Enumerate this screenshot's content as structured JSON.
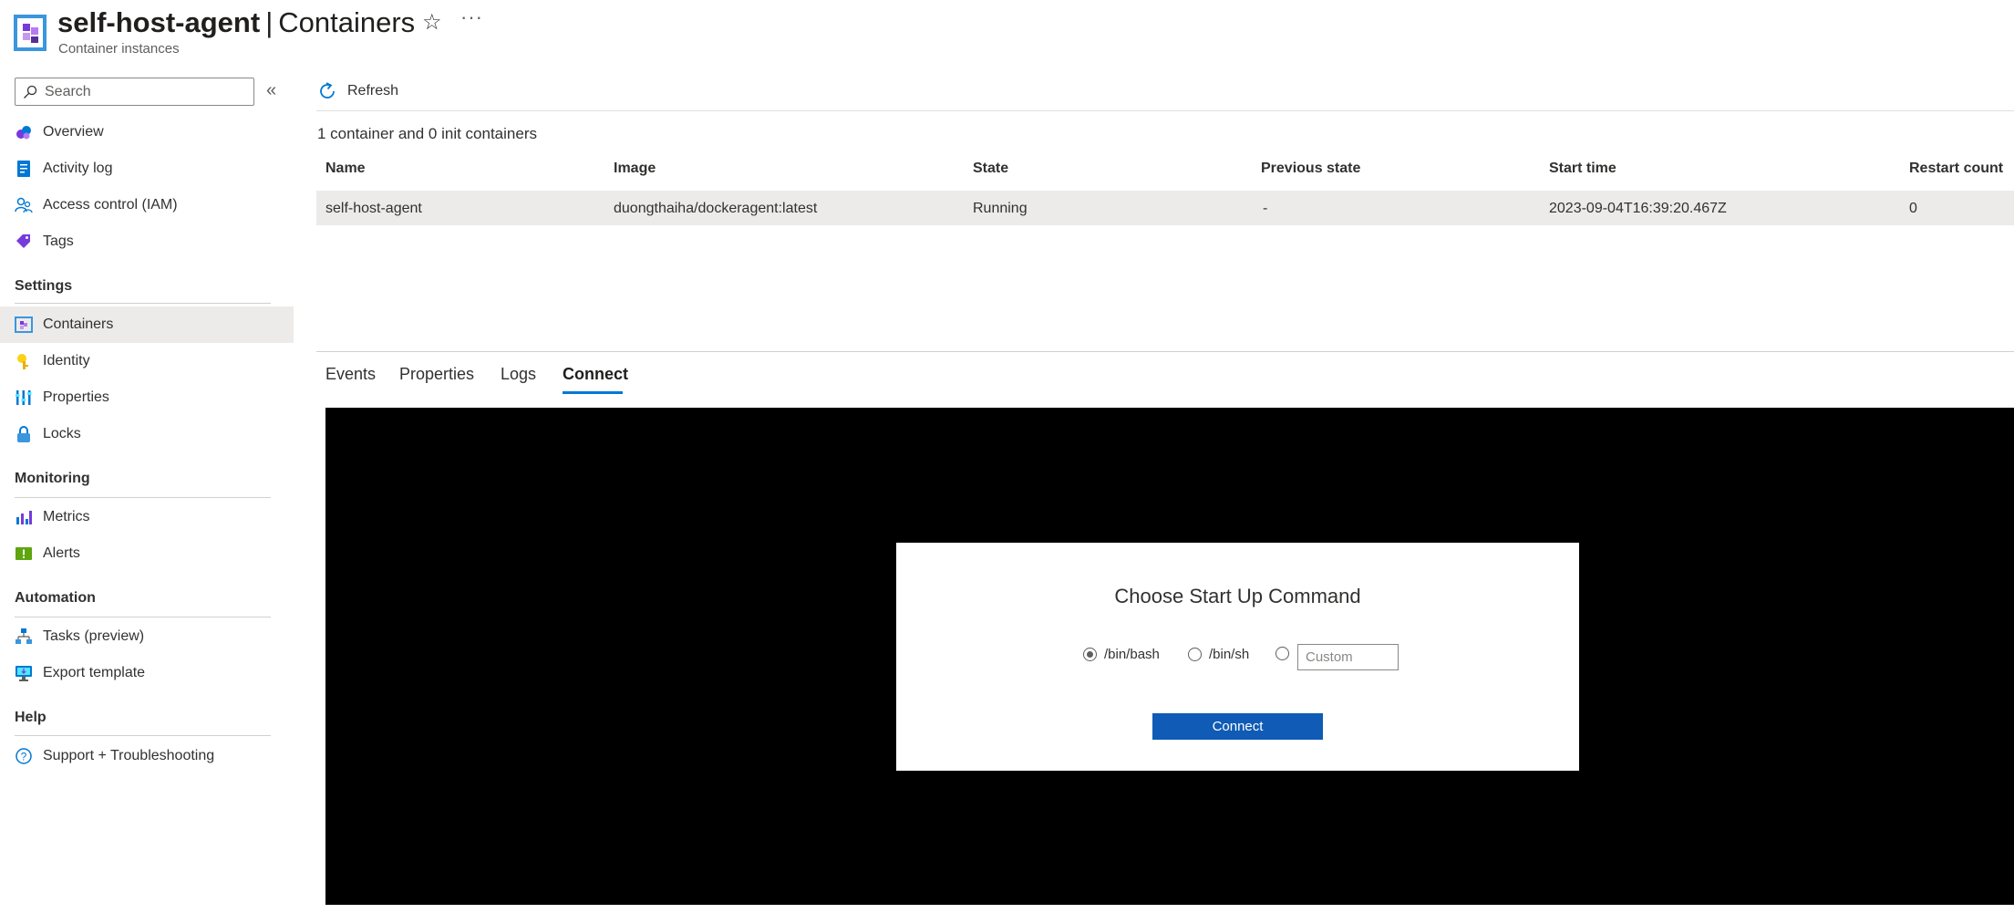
{
  "header": {
    "resource_name": "self-host-agent",
    "separator": "|",
    "page_name": "Containers",
    "subtitle": "Container instances",
    "favorite_icon": "star-icon",
    "more_icon": "ellipsis-icon"
  },
  "sidebar": {
    "search_placeholder": "Search",
    "collapse_glyph": "«",
    "top_items": [
      {
        "label": "Overview",
        "icon": "overview-icon"
      },
      {
        "label": "Activity log",
        "icon": "activity-log-icon"
      },
      {
        "label": "Access control (IAM)",
        "icon": "iam-icon"
      },
      {
        "label": "Tags",
        "icon": "tag-icon"
      }
    ],
    "sections": [
      {
        "title": "Settings",
        "items": [
          {
            "label": "Containers",
            "icon": "containers-icon",
            "active": true
          },
          {
            "label": "Identity",
            "icon": "identity-icon"
          },
          {
            "label": "Properties",
            "icon": "properties-icon"
          },
          {
            "label": "Locks",
            "icon": "lock-icon"
          }
        ]
      },
      {
        "title": "Monitoring",
        "items": [
          {
            "label": "Metrics",
            "icon": "metrics-icon"
          },
          {
            "label": "Alerts",
            "icon": "alerts-icon"
          }
        ]
      },
      {
        "title": "Automation",
        "items": [
          {
            "label": "Tasks (preview)",
            "icon": "tasks-icon"
          },
          {
            "label": "Export template",
            "icon": "export-template-icon"
          }
        ]
      },
      {
        "title": "Help",
        "items": [
          {
            "label": "Support + Troubleshooting",
            "icon": "support-icon"
          }
        ]
      }
    ]
  },
  "toolbar": {
    "refresh_label": "Refresh"
  },
  "summary": "1 container and 0 init containers",
  "table": {
    "columns": [
      "Name",
      "Image",
      "State",
      "Previous state",
      "Start time",
      "Restart count"
    ],
    "rows": [
      [
        "self-host-agent",
        "duongthaiha/dockeragent:latest",
        "Running",
        "-",
        "2023-09-04T16:39:20.467Z",
        "0"
      ]
    ]
  },
  "tabs": [
    {
      "label": "Events"
    },
    {
      "label": "Properties"
    },
    {
      "label": "Logs"
    },
    {
      "label": "Connect",
      "active": true
    }
  ],
  "connect_dialog": {
    "title": "Choose Start Up Command",
    "options": [
      {
        "label": "/bin/bash",
        "selected": true
      },
      {
        "label": "/bin/sh",
        "selected": false
      }
    ],
    "custom_placeholder": "Custom",
    "button_label": "Connect"
  },
  "colors": {
    "accent": "#0078d4",
    "button": "#0f5bb5",
    "selected_row": "#edebe9",
    "terminal": "#000000"
  }
}
